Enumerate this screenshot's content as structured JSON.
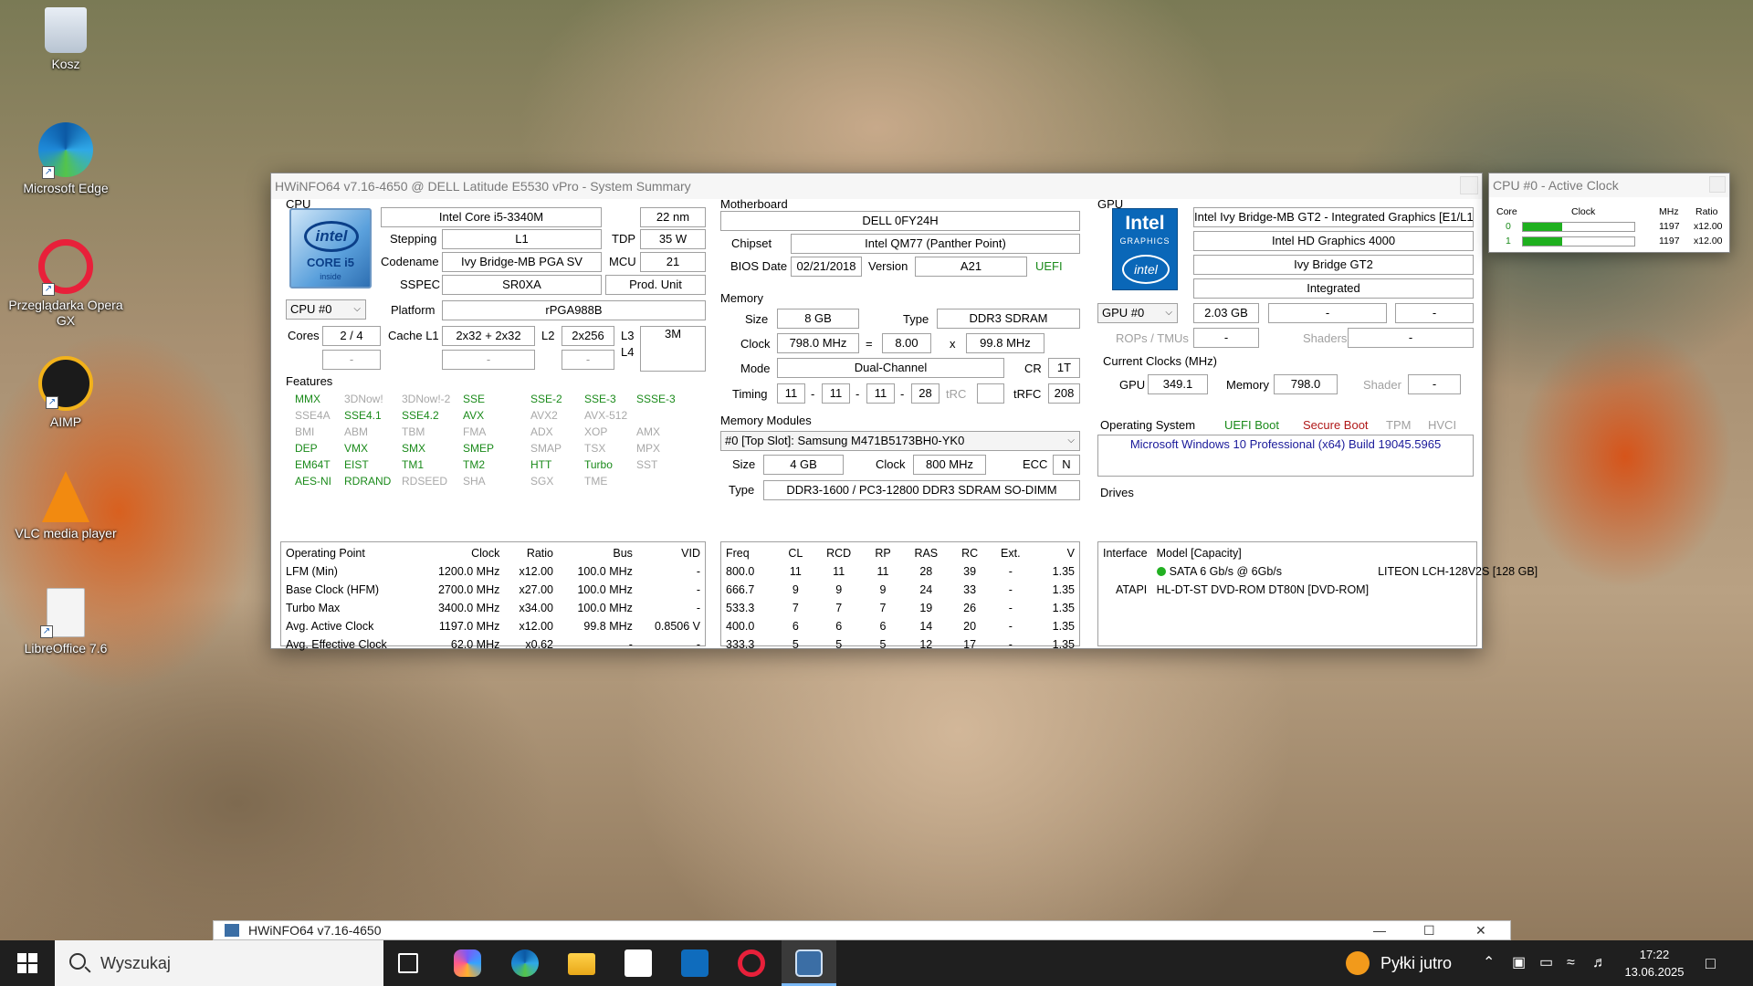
{
  "desktop": {
    "icons": [
      {
        "label": "Kosz",
        "icon": "recycle-bin-icon"
      },
      {
        "label": "Microsoft Edge",
        "icon": "edge-icon"
      },
      {
        "label": "Przeglądarka Opera GX",
        "icon": "opera-gx-icon"
      },
      {
        "label": "AIMP",
        "icon": "aimp-icon"
      },
      {
        "label": "VLC media player",
        "icon": "vlc-icon"
      },
      {
        "label": "LibreOffice 7.6",
        "icon": "libreoffice-icon"
      }
    ]
  },
  "main_window": {
    "title": "HWiNFO64 v7.16-4650 @ DELL Latitude E5530 vPro - System Summary",
    "cpu": {
      "section": "CPU",
      "logo": {
        "brand": "intel",
        "line": "CORE i5",
        "inside": "inside"
      },
      "name": "Intel Core i5-3340M",
      "process": "22 nm",
      "stepping_label": "Stepping",
      "stepping": "L1",
      "tdp_label": "TDP",
      "tdp": "35 W",
      "codename_label": "Codename",
      "codename": "Ivy Bridge-MB PGA SV",
      "mcu_label": "MCU",
      "mcu": "21",
      "sspec_label": "SSPEC",
      "sspec": "SR0XA",
      "prod_unit": "Prod. Unit",
      "selector": "CPU #0",
      "platform_label": "Platform",
      "platform": "rPGA988B",
      "cores_label": "Cores",
      "cores": "2 / 4",
      "cache_l1_label": "Cache L1",
      "cache_l1": "2x32 + 2x32",
      "l2_label": "L2",
      "l2": "2x256",
      "l3_label": "L3",
      "l3": "3M",
      "l4_label": "L4",
      "dash": "-",
      "features_label": "Features",
      "features": [
        {
          "name": "MMX",
          "on": true
        },
        {
          "name": "3DNow!",
          "on": false
        },
        {
          "name": "3DNow!-2",
          "on": false
        },
        {
          "name": "SSE",
          "on": true
        },
        {
          "name": "SSE-2",
          "on": true
        },
        {
          "name": "SSE-3",
          "on": true
        },
        {
          "name": "SSSE-3",
          "on": true
        },
        {
          "name": "SSE4A",
          "on": false
        },
        {
          "name": "SSE4.1",
          "on": true
        },
        {
          "name": "SSE4.2",
          "on": true
        },
        {
          "name": "AVX",
          "on": true
        },
        {
          "name": "AVX2",
          "on": false
        },
        {
          "name": "AVX-512",
          "on": false
        },
        {
          "name": "",
          "on": false
        },
        {
          "name": "BMI",
          "on": false
        },
        {
          "name": "ABM",
          "on": false
        },
        {
          "name": "TBM",
          "on": false
        },
        {
          "name": "FMA",
          "on": false
        },
        {
          "name": "ADX",
          "on": false
        },
        {
          "name": "XOP",
          "on": false
        },
        {
          "name": "AMX",
          "on": false
        },
        {
          "name": "DEP",
          "on": true
        },
        {
          "name": "VMX",
          "on": true
        },
        {
          "name": "SMX",
          "on": true
        },
        {
          "name": "SMEP",
          "on": true
        },
        {
          "name": "SMAP",
          "on": false
        },
        {
          "name": "TSX",
          "on": false
        },
        {
          "name": "MPX",
          "on": false
        },
        {
          "name": "EM64T",
          "on": true
        },
        {
          "name": "EIST",
          "on": true
        },
        {
          "name": "TM1",
          "on": true
        },
        {
          "name": "TM2",
          "on": true
        },
        {
          "name": "HTT",
          "on": true
        },
        {
          "name": "Turbo",
          "on": true
        },
        {
          "name": "SST",
          "on": false
        },
        {
          "name": "AES-NI",
          "on": true
        },
        {
          "name": "RDRAND",
          "on": true
        },
        {
          "name": "RDSEED",
          "on": false
        },
        {
          "name": "SHA",
          "on": false
        },
        {
          "name": "SGX",
          "on": false
        },
        {
          "name": "TME",
          "on": false
        },
        {
          "name": "",
          "on": false
        }
      ],
      "op_table": {
        "headers": [
          "Operating Point",
          "Clock",
          "Ratio",
          "Bus",
          "VID"
        ],
        "rows": [
          [
            "LFM (Min)",
            "1200.0 MHz",
            "x12.00",
            "100.0 MHz",
            "-"
          ],
          [
            "Base Clock (HFM)",
            "2700.0 MHz",
            "x27.00",
            "100.0 MHz",
            "-"
          ],
          [
            "Turbo Max",
            "3400.0 MHz",
            "x34.00",
            "100.0 MHz",
            "-"
          ],
          [
            "Avg. Active Clock",
            "1197.0 MHz",
            "x12.00",
            "99.8 MHz",
            "0.8506 V"
          ],
          [
            "Avg. Effective Clock",
            "62.0 MHz",
            "x0.62",
            "-",
            "-"
          ]
        ]
      }
    },
    "motherboard": {
      "section": "Motherboard",
      "name": "DELL 0FY24H",
      "chipset_label": "Chipset",
      "chipset": "Intel QM77 (Panther Point)",
      "bios_date_label": "BIOS Date",
      "bios_date": "02/21/2018",
      "version_label": "Version",
      "version": "A21",
      "uefi": "UEFI"
    },
    "memory": {
      "section": "Memory",
      "size_label": "Size",
      "size": "8 GB",
      "type_label": "Type",
      "type": "DDR3 SDRAM",
      "clock_label": "Clock",
      "clock": "798.0 MHz",
      "eq": "=",
      "multiplier": "8.00",
      "x": "x",
      "bus": "99.8 MHz",
      "mode_label": "Mode",
      "mode": "Dual-Channel",
      "cr_label": "CR",
      "cr": "1T",
      "timing_label": "Timing",
      "t1": "11",
      "t2": "11",
      "t3": "11",
      "t4": "28",
      "sep": "-",
      "trc_label": "tRC",
      "trfc_label": "tRFC",
      "trfc": "208"
    },
    "memory_modules": {
      "section": "Memory Modules",
      "selected": "#0 [Top Slot]: Samsung M471B5173BH0-YK0",
      "size_label": "Size",
      "size": "4 GB",
      "clock_label": "Clock",
      "clock": "800 MHz",
      "ecc_label": "ECC",
      "ecc": "N",
      "type_label": "Type",
      "type": "DDR3-1600 / PC3-12800 DDR3 SDRAM SO-DIMM",
      "timing_table": {
        "headers": [
          "Freq",
          "CL",
          "RCD",
          "RP",
          "RAS",
          "RC",
          "Ext.",
          "V"
        ],
        "rows": [
          [
            "800.0",
            "11",
            "11",
            "11",
            "28",
            "39",
            "-",
            "1.35"
          ],
          [
            "666.7",
            "9",
            "9",
            "9",
            "24",
            "33",
            "-",
            "1.35"
          ],
          [
            "533.3",
            "7",
            "7",
            "7",
            "19",
            "26",
            "-",
            "1.35"
          ],
          [
            "400.0",
            "6",
            "6",
            "6",
            "14",
            "20",
            "-",
            "1.35"
          ],
          [
            "333.3",
            "5",
            "5",
            "5",
            "12",
            "17",
            "-",
            "1.35"
          ]
        ]
      }
    },
    "gpu": {
      "section": "GPU",
      "logo": {
        "brand": "Intel",
        "line": "GRAPHICS",
        "mark": "intel"
      },
      "name": "Intel Ivy Bridge-MB GT2 - Integrated Graphics [E1/L1]",
      "model": "Intel HD Graphics 4000",
      "codename": "Ivy Bridge GT2",
      "type": "Integrated",
      "selector": "GPU #0",
      "vram": "2.03 GB",
      "dash": "-",
      "rops_label": "ROPs / TMUs",
      "shaders_label": "Shaders",
      "clocks_label": "Current Clocks (MHz)",
      "gpu_clock_label": "GPU",
      "gpu_clock": "349.1",
      "mem_clock_label": "Memory",
      "mem_clock": "798.0",
      "shader_label": "Shader"
    },
    "os": {
      "section": "Operating System",
      "uefi_boot": "UEFI Boot",
      "secure_boot": "Secure Boot",
      "tpm": "TPM",
      "hvci": "HVCI",
      "name": "Microsoft Windows 10 Professional (x64) Build 19045.5965"
    },
    "drives": {
      "section": "Drives",
      "headers": [
        "Interface",
        "Model [Capacity]"
      ],
      "rows": [
        [
          "SATA 6 Gb/s @ 6Gb/s",
          "LITEON LCH-128V2S [128 GB]"
        ],
        [
          "ATAPI",
          "HL-DT-ST DVD-ROM DT80N [DVD-ROM]"
        ]
      ]
    }
  },
  "clock_window": {
    "title": "CPU #0 - Active Clock",
    "headers": [
      "Core",
      "Clock",
      "MHz",
      "Ratio"
    ],
    "cores": [
      {
        "core": "0",
        "mhz": "1197",
        "ratio": "x12.00",
        "level": 0.35
      },
      {
        "core": "1",
        "mhz": "1197",
        "ratio": "x12.00",
        "level": 0.35
      }
    ]
  },
  "preview_window": {
    "title": "HWiNFO64 v7.16-4650"
  },
  "taskbar": {
    "search_placeholder": "Wyszukaj",
    "weather": "Pyłki jutro",
    "time": "17:22",
    "date": "13.06.2025"
  },
  "colors": {
    "feature_on": "#1a8a1a",
    "feature_off": "#a8a8a8",
    "secure_boot": "#b01818",
    "accent": "#0a67b8"
  }
}
